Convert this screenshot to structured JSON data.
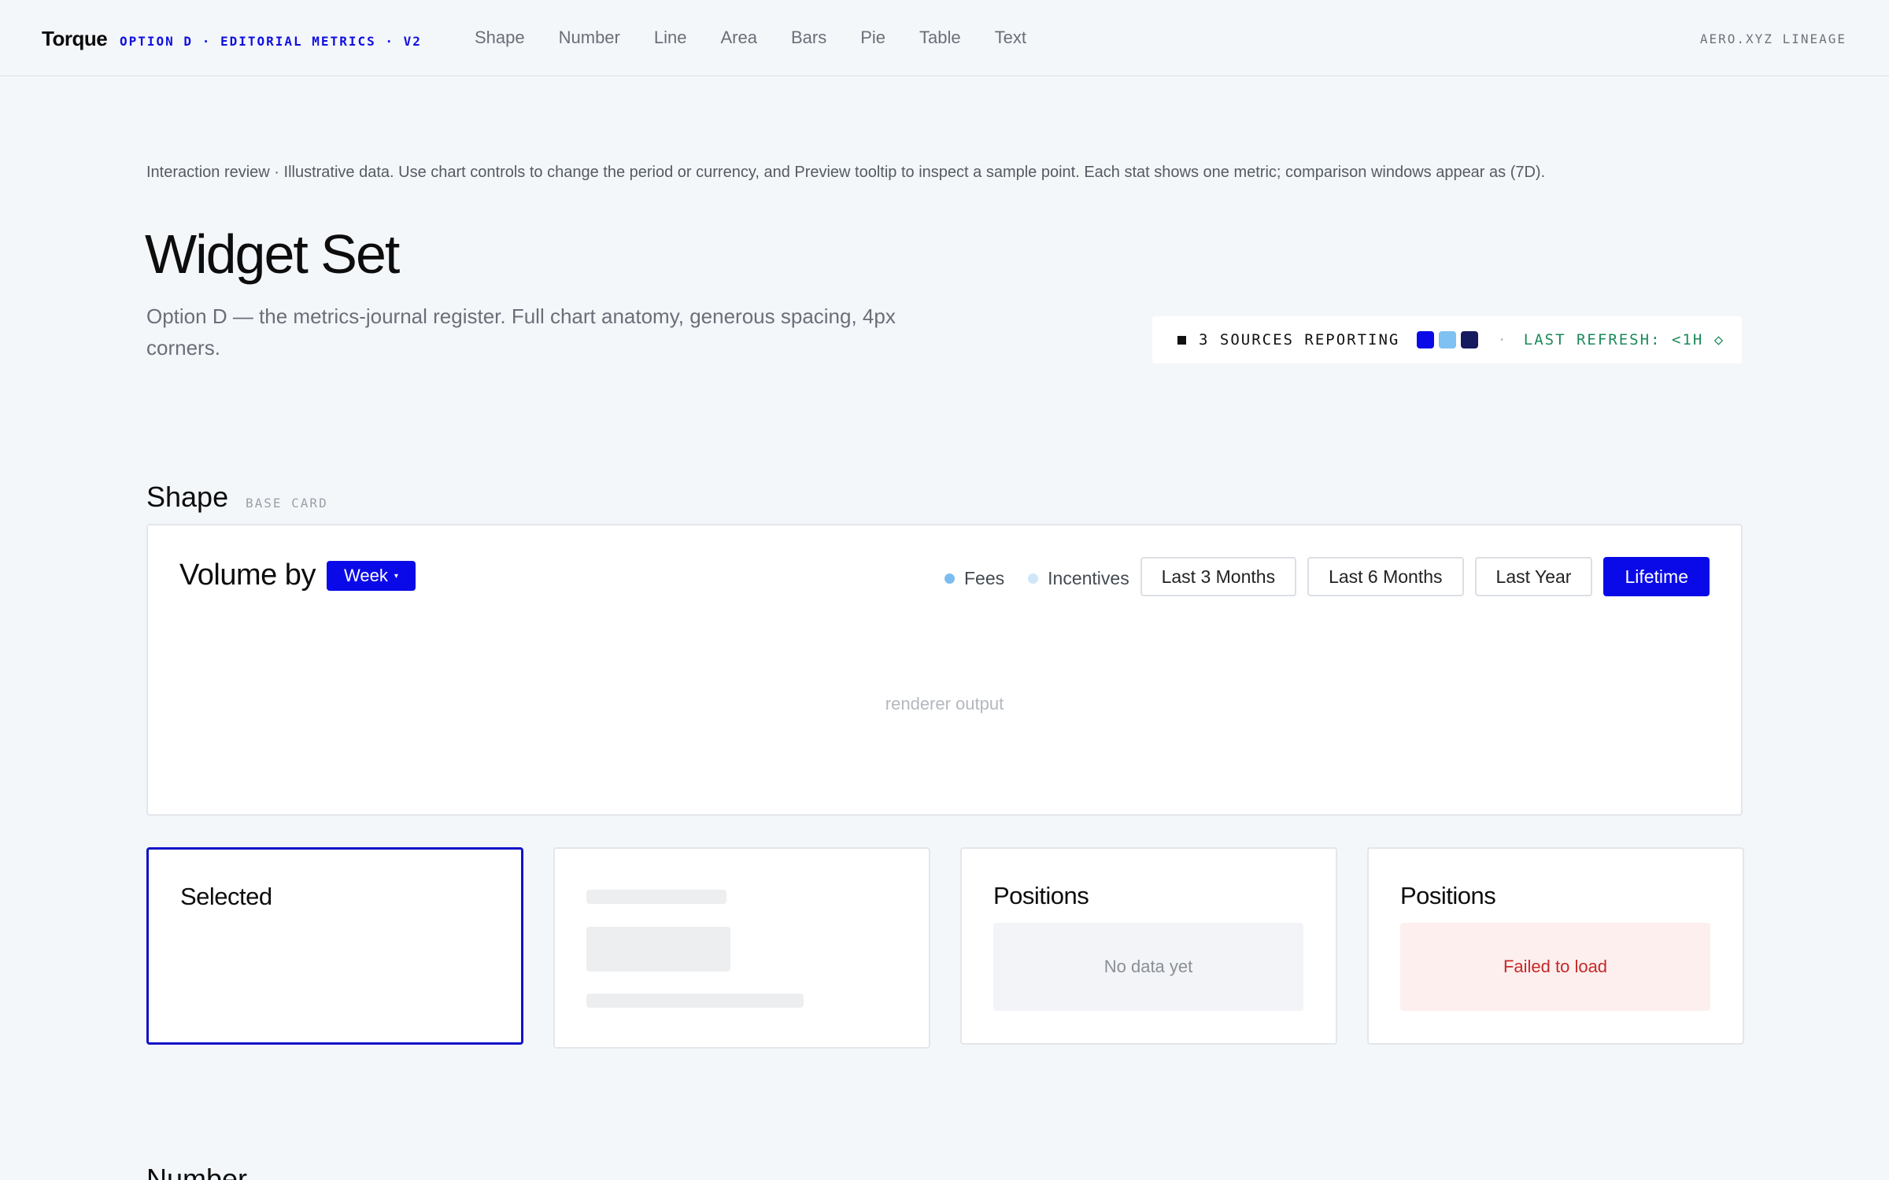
{
  "header": {
    "brand": "Torque",
    "brand_sub": "OPTION D · EDITORIAL METRICS · V2",
    "nav": [
      "Shape",
      "Number",
      "Line",
      "Area",
      "Bars",
      "Pie",
      "Table",
      "Text"
    ],
    "lineage": "AERO.XYZ LINEAGE"
  },
  "intro": {
    "note": "Interaction review · Illustrative data. Use chart controls to change the period or currency, and Preview tooltip to inspect a sample point. Each stat shows one metric; comparison windows appear as (7D).",
    "title": "Widget Set",
    "subtitle": "Option D — the metrics-journal register. Full chart anatomy, generous spacing, 4px corners."
  },
  "status": {
    "sources": "3 SOURCES REPORTING",
    "source_colors": [
      "#0a0ae8",
      "#7fc1f2",
      "#161a5e"
    ],
    "separator": "·",
    "refresh": "LAST REFRESH: <1H ◇"
  },
  "section": {
    "title": "Shape",
    "tag": "BASE CARD"
  },
  "main_card": {
    "title": "Volume by",
    "week_label": "Week",
    "week_chevron": "▾",
    "legend": [
      {
        "label": "Fees",
        "color": "#7bbcf0"
      },
      {
        "label": "Incentives",
        "color": "#cfe6f8"
      }
    ],
    "ranges": [
      "Last 3 Months",
      "Last 6 Months",
      "Last Year",
      "Lifetime"
    ],
    "active_range": "Lifetime",
    "renderer_label": "renderer output"
  },
  "cards": {
    "selected_title": "Selected",
    "empty_title": "Positions",
    "empty_text": "No data yet",
    "error_title": "Positions",
    "error_text": "Failed to load"
  },
  "next_section": "Number"
}
